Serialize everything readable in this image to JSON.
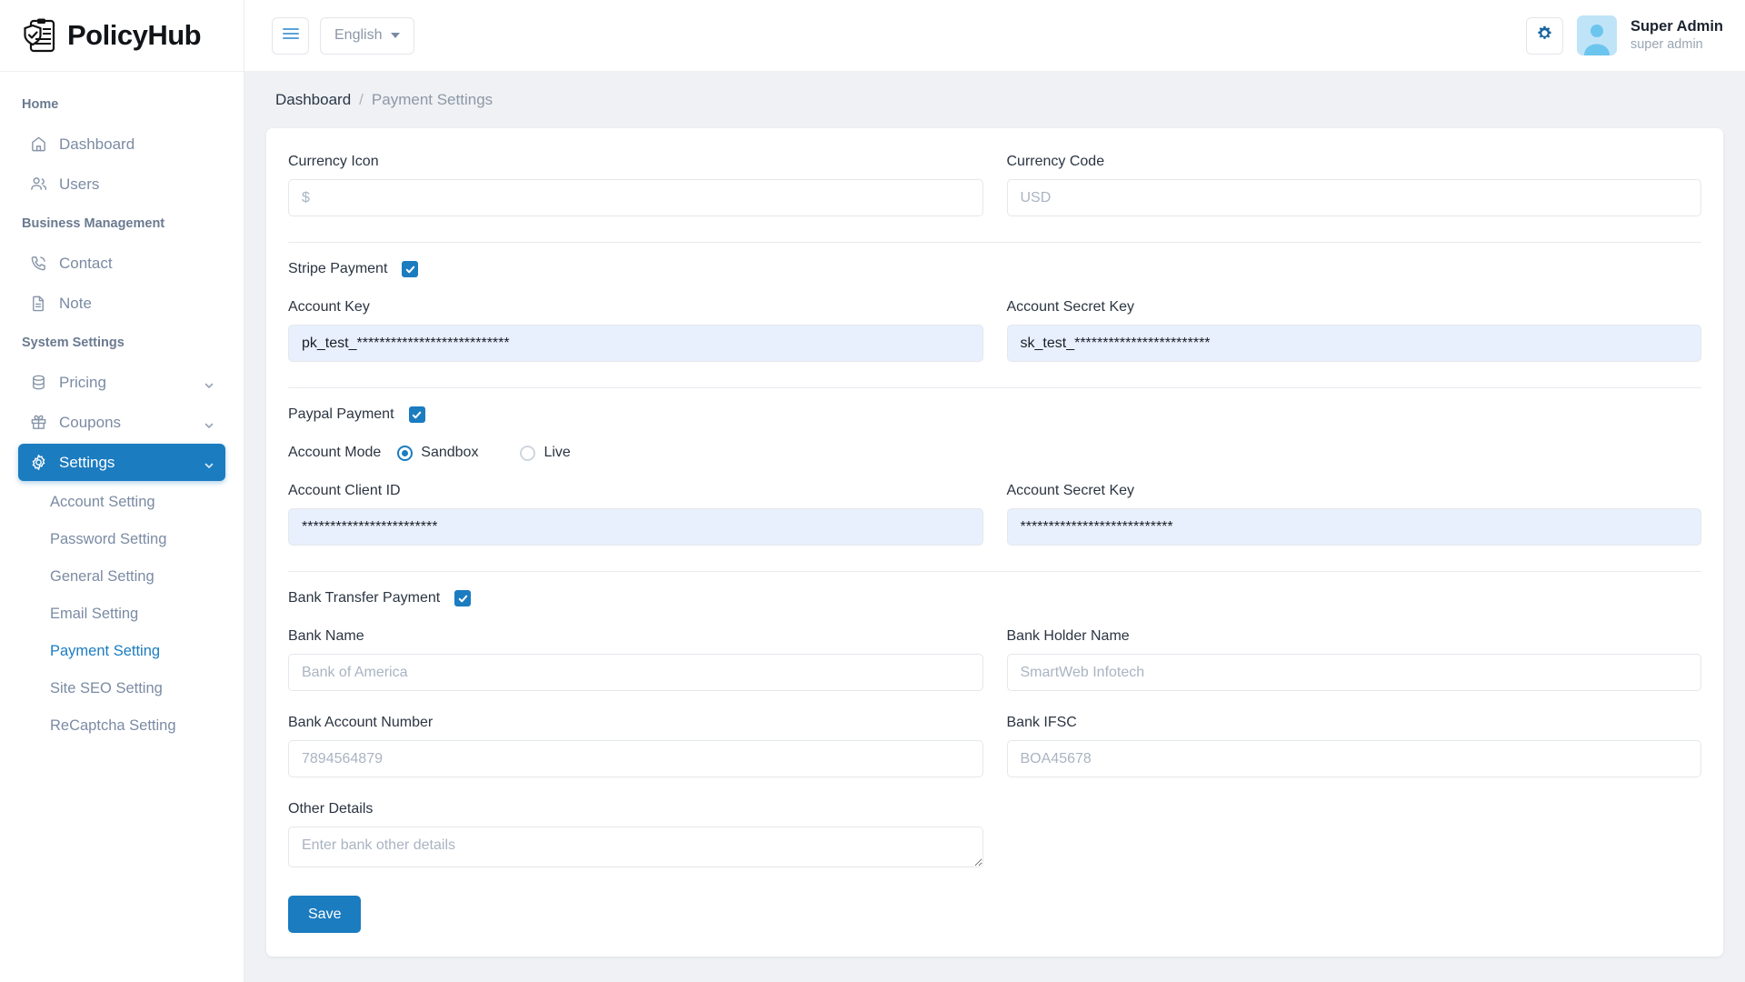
{
  "brand": {
    "name": "PolicyHub",
    "icon": "clipboard-shield-icon"
  },
  "sidebar": {
    "sections": [
      {
        "title": "Home"
      },
      {
        "title": "Business Management"
      },
      {
        "title": "System Settings"
      }
    ],
    "items": [
      {
        "label": "Dashboard",
        "icon": "home-icon"
      },
      {
        "label": "Users",
        "icon": "users-icon"
      },
      {
        "label": "Contact",
        "icon": "phone-icon"
      },
      {
        "label": "Note",
        "icon": "file-text-icon"
      },
      {
        "label": "Pricing",
        "icon": "database-icon"
      },
      {
        "label": "Coupons",
        "icon": "gift-icon"
      },
      {
        "label": "Settings",
        "icon": "gear-icon"
      }
    ],
    "subitems": [
      {
        "label": "Account Setting"
      },
      {
        "label": "Password Setting"
      },
      {
        "label": "General Setting"
      },
      {
        "label": "Email Setting"
      },
      {
        "label": "Payment Setting"
      },
      {
        "label": "Site SEO Setting"
      },
      {
        "label": "ReCaptcha Setting"
      }
    ]
  },
  "topbar": {
    "menu_icon": "hamburger-icon",
    "language": "English",
    "settings_icon": "gear-icon",
    "user_name": "Super Admin",
    "user_role": "super admin"
  },
  "breadcrumb": {
    "home": "Dashboard",
    "separator": "/",
    "current": "Payment Settings"
  },
  "form": {
    "currency_icon": {
      "label": "Currency Icon",
      "placeholder": "$",
      "value": ""
    },
    "currency_code": {
      "label": "Currency Code",
      "placeholder": "USD",
      "value": ""
    },
    "stripe": {
      "label": "Stripe Payment",
      "checked": true,
      "account_key": {
        "label": "Account Key",
        "value": "pk_test_***************************"
      },
      "account_secret_key": {
        "label": "Account Secret Key",
        "value": "sk_test_************************"
      }
    },
    "paypal": {
      "label": "Paypal Payment",
      "checked": true,
      "mode_label": "Account Mode",
      "mode_options": [
        "Sandbox",
        "Live"
      ],
      "mode_selected": "Sandbox",
      "client_id": {
        "label": "Account Client ID",
        "value": "************************"
      },
      "secret_key": {
        "label": "Account Secret Key",
        "value": "***************************"
      }
    },
    "bank": {
      "label": "Bank Transfer Payment",
      "checked": true,
      "bank_name": {
        "label": "Bank Name",
        "placeholder": "Bank of America",
        "value": ""
      },
      "holder_name": {
        "label": "Bank Holder Name",
        "placeholder": "SmartWeb Infotech",
        "value": ""
      },
      "account_number": {
        "label": "Bank Account Number",
        "placeholder": "7894564879",
        "value": ""
      },
      "ifsc": {
        "label": "Bank IFSC",
        "placeholder": "BOA45678",
        "value": ""
      },
      "other_details": {
        "label": "Other Details",
        "placeholder": "Enter bank other details",
        "value": ""
      }
    },
    "save_label": "Save"
  },
  "colors": {
    "accent": "#1b7cc0",
    "autofill": "#e8f0fe",
    "sidebar_text": "#7b8ba3",
    "page_bg": "#f0f1f4"
  }
}
